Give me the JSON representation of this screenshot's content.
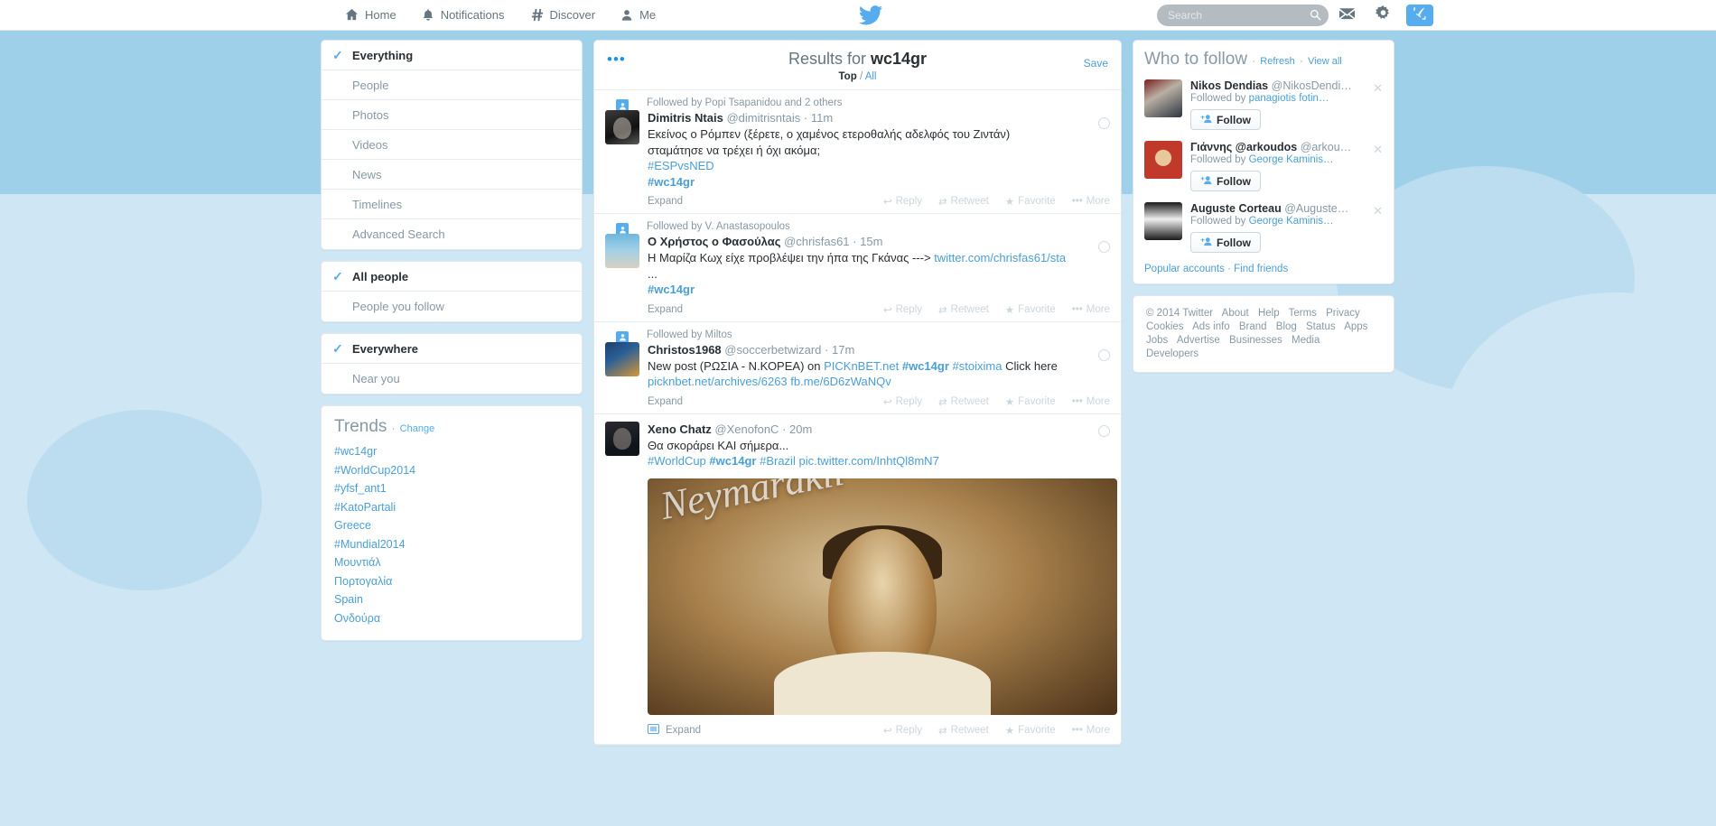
{
  "nav": {
    "items": [
      {
        "label": "Home",
        "icon": "home-icon"
      },
      {
        "label": "Notifications",
        "icon": "bell-icon"
      },
      {
        "label": "Discover",
        "icon": "hash-icon"
      },
      {
        "label": "Me",
        "icon": "person-icon"
      }
    ],
    "logo": "twitter-bird-icon",
    "search": {
      "placeholder": "Search",
      "value": "",
      "icon": "search-icon"
    },
    "messages_icon": "envelope-icon",
    "settings_icon": "gear-icon",
    "compose_icon": "compose-icon"
  },
  "sidebar": {
    "group1": [
      {
        "label": "Everything",
        "active": true
      },
      {
        "label": "People",
        "active": false
      },
      {
        "label": "Photos",
        "active": false
      },
      {
        "label": "Videos",
        "active": false
      },
      {
        "label": "News",
        "active": false
      },
      {
        "label": "Timelines",
        "active": false
      },
      {
        "label": "Advanced Search",
        "active": false
      }
    ],
    "group2": [
      {
        "label": "All people",
        "active": true
      },
      {
        "label": "People you follow",
        "active": false
      }
    ],
    "group3": [
      {
        "label": "Everywhere",
        "active": true
      },
      {
        "label": "Near you",
        "active": false
      }
    ],
    "trends": {
      "title": "Trends",
      "change_label": "Change",
      "items": [
        "#wc14gr",
        "#WorldCup2014",
        "#yfsf_ant1",
        "#KatoPartali",
        "Greece",
        "#Mundial2014",
        "Μουντιάλ",
        "Πορτογαλία",
        "Spain",
        "Ονδούρα"
      ]
    }
  },
  "results": {
    "title_prefix": "Results for",
    "query": "wc14gr",
    "save_label": "Save",
    "menu_icon": "more-dots-icon",
    "tabs": {
      "top": "Top",
      "sep": "/",
      "all": "All"
    },
    "actions": {
      "expand": "Expand",
      "reply": "Reply",
      "retweet": "Retweet",
      "favorite": "Favorite",
      "more": "More"
    }
  },
  "tweets": [
    {
      "context": "Followed by Popi Tsapanidou and 2 others",
      "name": "Dimitris Ntais",
      "handle": "@dimitrisntais",
      "time": "11m",
      "text_lines": [
        "Εκείνος ο Ρόμπεν (ξέρετε, ο χαμένος ετεροθαλής αδελφός του Ζιντάν)",
        "σταμάτησε να τρέχει ή όχι ακόμα;"
      ],
      "tags": [
        "#ESPvsNED",
        "#wc14gr"
      ],
      "avatar_class": "av1"
    },
    {
      "context": "Followed by V. Anastasopoulos",
      "name": "Ο Χρήστος ο Φασούλας",
      "handle": "@chrisfas61",
      "time": "15m",
      "text_lines": [
        "Η Μαρίζα Κωχ είχε προβλέψει την ήπα της Γκάνας --->",
        "..."
      ],
      "link": "twitter.com/chrisfas61/sta",
      "tags": [
        "#wc14gr"
      ],
      "avatar_class": "av2"
    },
    {
      "context": "Followed by Miltos",
      "name": "Christos1968",
      "handle": "@soccerbetwizard",
      "time": "17m",
      "text_pre": "New post (ΡΩΣΙΑ - Ν.ΚΟΡΕΑ) on",
      "link1": "PICKnBET.net",
      "tag1": "#wc14gr",
      "tag2": "#stoixima",
      "text_post": "Click here",
      "link2": "picknbet.net/archives/6263",
      "link3": "fb.me/6D6zWaNQv",
      "avatar_class": "av3"
    },
    {
      "context": "",
      "name": "Xeno Chatz",
      "handle": "@XenofonC",
      "time": "20m",
      "text_lines": [
        "Θα σκοράρει ΚΑΙ σήμερα..."
      ],
      "tags": [
        "#WorldCup",
        "#wc14gr",
        "#Brazil"
      ],
      "photo_link": "pic.twitter.com/InhtQl8mN7",
      "photo_caption": "Neymarákii",
      "avatar_class": "av4"
    }
  ],
  "who_to_follow": {
    "title": "Who to follow",
    "refresh_label": "Refresh",
    "view_all_label": "View all",
    "follow_label": "Follow",
    "people": [
      {
        "name": "Nikos Dendias",
        "handle": "@NikosDendi…",
        "followed_by_prefix": "Followed by",
        "followed_by": "panagiotis fotin…",
        "avatar_class": "wa1"
      },
      {
        "name": "Γιάννης @arkoudos",
        "handle": "@arkou…",
        "followed_by_prefix": "Followed by",
        "followed_by": "George Kaminis…",
        "avatar_class": "wa2"
      },
      {
        "name": "Auguste Corteau",
        "handle": "@Auguste…",
        "followed_by_prefix": "Followed by",
        "followed_by": "George Kaminis…",
        "avatar_class": "wa3"
      }
    ],
    "popular_accounts": "Popular accounts",
    "find_friends": "Find friends"
  },
  "footer": {
    "links": [
      "© 2014 Twitter",
      "About",
      "Help",
      "Terms",
      "Privacy",
      "Cookies",
      "Ads info",
      "Brand",
      "Blog",
      "Status",
      "Apps",
      "Jobs",
      "Advertise",
      "Businesses",
      "Media",
      "Developers"
    ]
  }
}
